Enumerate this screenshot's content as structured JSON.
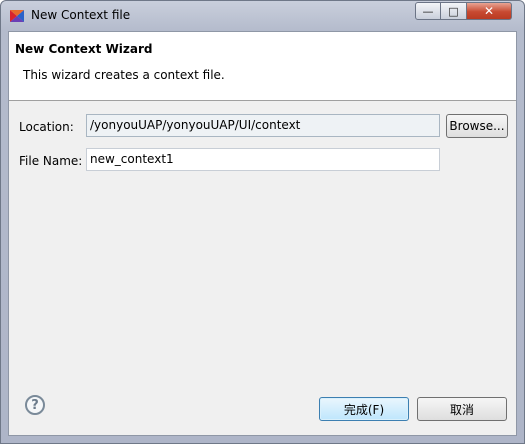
{
  "window": {
    "title": "New Context file",
    "minimize_glyph": "—",
    "maximize_glyph": "□",
    "close_glyph": "✕"
  },
  "wizard": {
    "title": "New Context Wizard",
    "description": "This wizard creates a context file."
  },
  "form": {
    "location_label": "Location:",
    "location_value": "/yonyouUAP/yonyouUAP/UI/context",
    "browse_label": "Browse...",
    "filename_label": "File Name:",
    "filename_value": "new_context1"
  },
  "footer": {
    "help_glyph": "?",
    "finish_label": "完成(F)",
    "cancel_label": "取消"
  },
  "colors": {
    "title_gradient_top": "#c9cfdc",
    "close_red": "#c74a31",
    "default_button_blue": "#bee6fd"
  }
}
